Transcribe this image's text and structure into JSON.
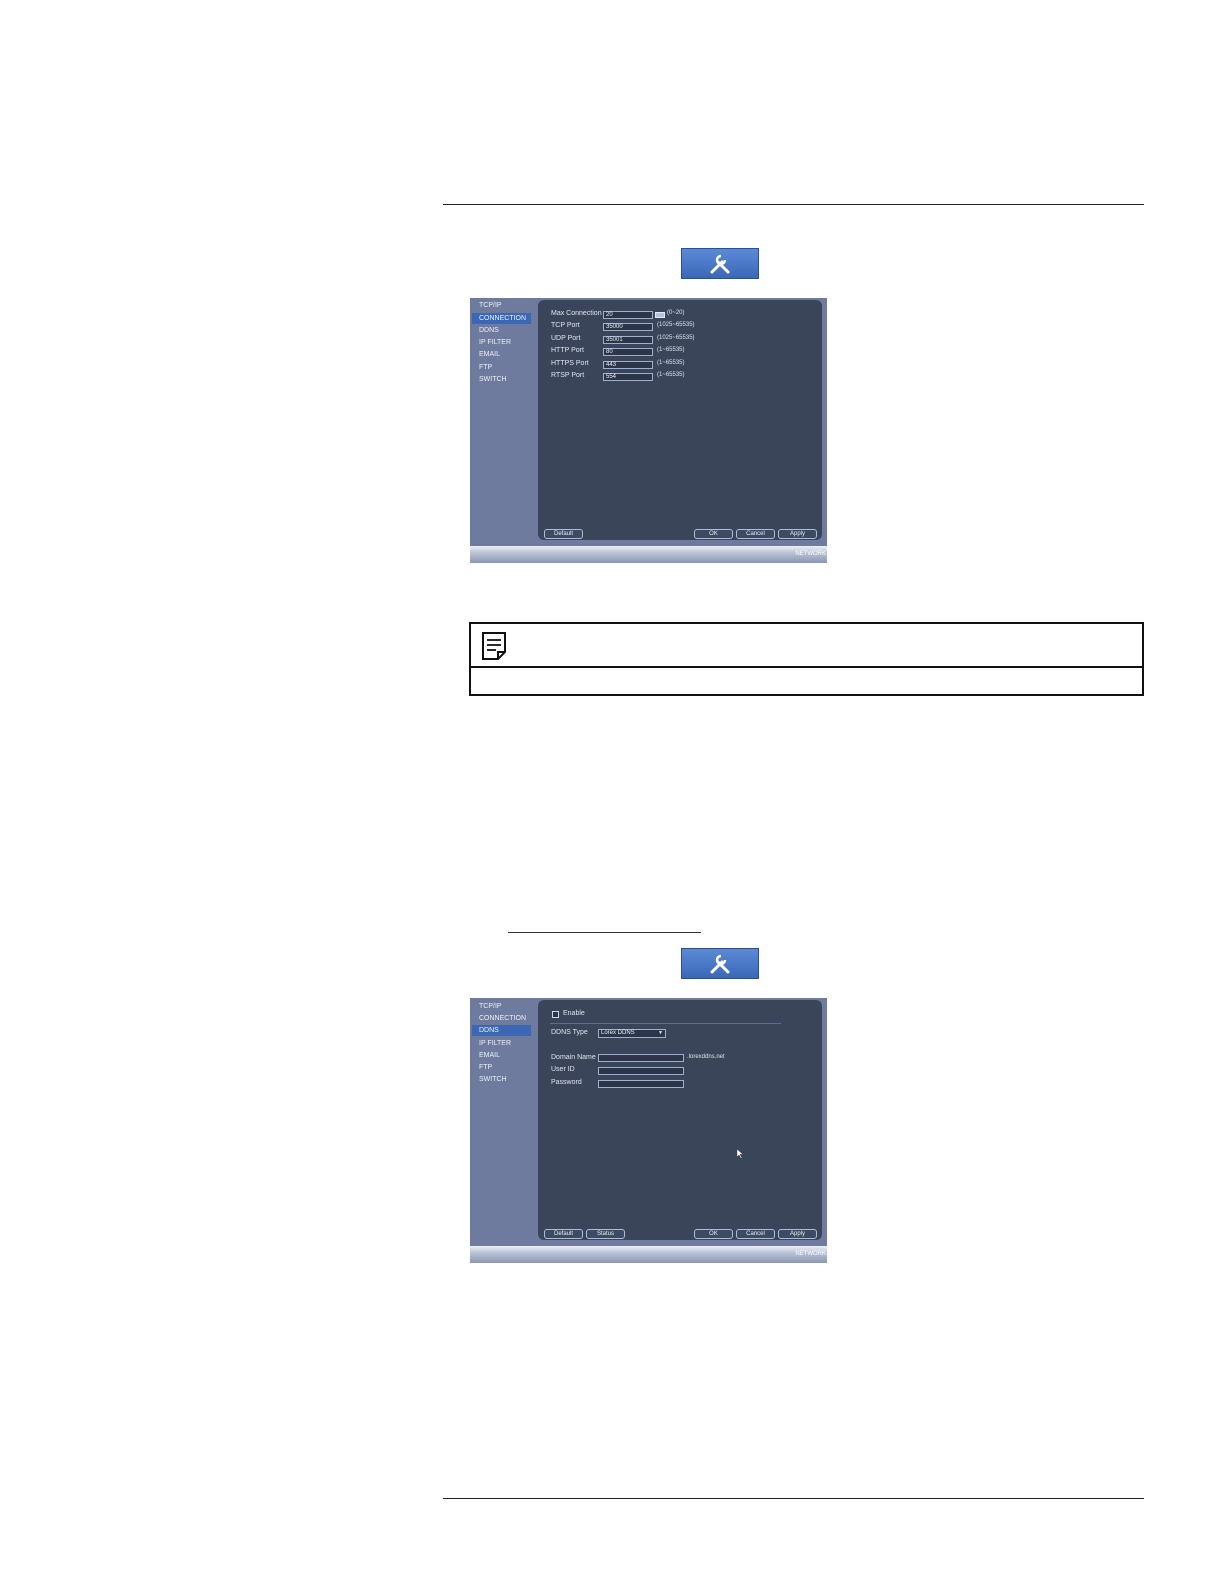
{
  "screen1": {
    "sidebar": [
      "TCP/IP",
      "CONNECTION",
      "DDNS",
      "IP FILTER",
      "EMAIL",
      "FTP",
      "SWITCH"
    ],
    "active_index": 1,
    "fields": [
      {
        "label": "Max Connection",
        "value": "20",
        "hint": "(0~20)"
      },
      {
        "label": "TCP Port",
        "value": "35000",
        "hint": "(1025~65535)"
      },
      {
        "label": "UDP Port",
        "value": "35001",
        "hint": "(1025~65535)"
      },
      {
        "label": "HTTP Port",
        "value": "80",
        "hint": "(1~65535)"
      },
      {
        "label": "HTTPS Port",
        "value": "443",
        "hint": "(1~65535)"
      },
      {
        "label": "RTSP Port",
        "value": "554",
        "hint": "(1~65535)"
      }
    ],
    "buttons": {
      "default": "Default",
      "ok": "OK",
      "cancel": "Cancel",
      "apply": "Apply"
    },
    "status": "NETWORK"
  },
  "screen2": {
    "sidebar": [
      "TCP/IP",
      "CONNECTION",
      "DDNS",
      "IP FILTER",
      "EMAIL",
      "FTP",
      "SWITCH"
    ],
    "active_index": 2,
    "enable_label": "Enable",
    "ddns_type_label": "DDNS Type",
    "ddns_type_value": "Lorex DDNS",
    "fields": [
      {
        "label": "Domain Name",
        "value": "",
        "suffix": ".lorexddns.net"
      },
      {
        "label": "User ID",
        "value": ""
      },
      {
        "label": "Password",
        "value": ""
      }
    ],
    "buttons": {
      "default": "Default",
      "status": "Status",
      "ok": "OK",
      "cancel": "Cancel",
      "apply": "Apply"
    },
    "status": "NETWORK"
  },
  "icons": {
    "tool_button": "tools-icon",
    "note": "note-icon",
    "cursor": "cursor-icon"
  }
}
